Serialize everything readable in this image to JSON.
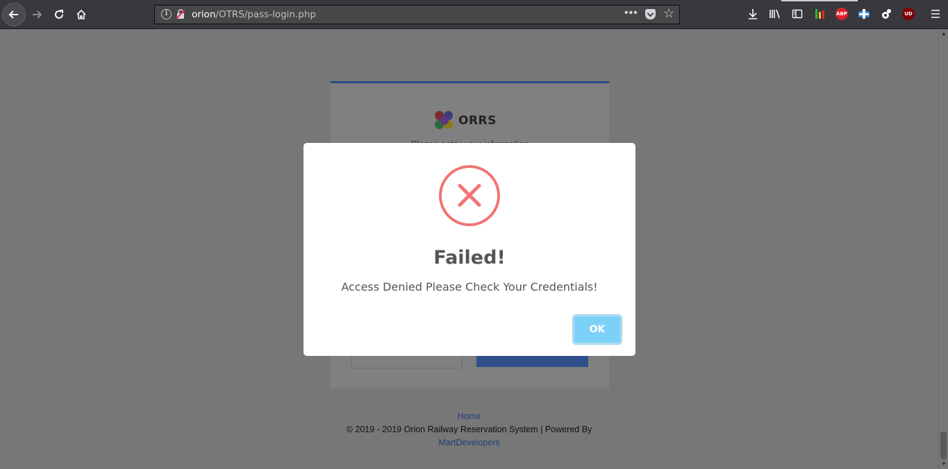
{
  "browser": {
    "url_host": "orion",
    "url_path": "/OTRS/pass-login.php",
    "url_more": "•••",
    "icons": [
      "back-icon",
      "forward-icon",
      "reload-icon",
      "home-icon",
      "info-icon",
      "insecure-lock-icon",
      "page-actions-icon",
      "pocket-icon",
      "bookmark-star-icon",
      "downloads-icon",
      "library-icon",
      "sidebar-icon",
      "extension-meter-icon",
      "adblock-plus-icon",
      "extension-puzzle-icon",
      "extension-gnome-icon",
      "ublock-icon",
      "menu-icon"
    ],
    "abp_label": "ABP",
    "ublock_label": "UD"
  },
  "card": {
    "logo_text": "ORRS",
    "subtitle": "Please enter your information"
  },
  "footer": {
    "home_link": "Home",
    "copyright": "© 2019 - 2019 Orion Railway Reservation System | Powered By",
    "developer_link": "MartDevelopers"
  },
  "modal": {
    "icon": "error-x-icon",
    "title": "Failed!",
    "message": "Access Denied Please Check Your Credentials!",
    "ok_label": "OK",
    "error_color": "#f27474",
    "button_color": "#7cd1f9"
  },
  "colors": {
    "overlay": "#777777",
    "toolbar": "#38383d",
    "link": "#1f3f7a"
  }
}
